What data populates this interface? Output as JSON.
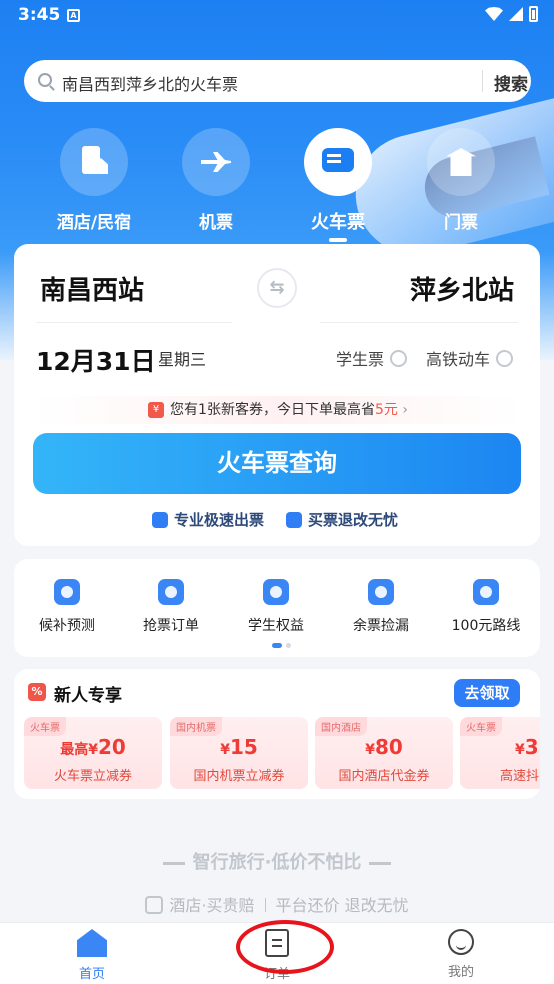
{
  "status_bar": {
    "time": "3:45",
    "notif_icon": "A"
  },
  "search": {
    "placeholder": "南昌西到萍乡北的火车票",
    "button": "搜索"
  },
  "categories": [
    {
      "label": "酒店/民宿",
      "icon": "hotel-icon"
    },
    {
      "label": "机票",
      "icon": "plane-icon"
    },
    {
      "label": "火车票",
      "icon": "train-icon",
      "active": true
    },
    {
      "label": "门票",
      "icon": "ticket-icon"
    }
  ],
  "booking": {
    "from": "南昌西站",
    "to": "萍乡北站",
    "date": "12月31日",
    "weekday": "星期三",
    "student": "学生票",
    "highspeed": "高铁动车",
    "coupon_prefix": "您有1张新客券，今日下单最高省",
    "coupon_amount": "5元",
    "query_button": "火车票查询",
    "feature1": "专业极速出票",
    "feature2": "买票退改无忧"
  },
  "tools": [
    {
      "label": "候补预测",
      "icon": "shield-chart-icon"
    },
    {
      "label": "抢票订单",
      "icon": "grab-ticket-icon"
    },
    {
      "label": "学生权益",
      "icon": "graduation-cap-icon"
    },
    {
      "label": "余票捡漏",
      "icon": "refresh-icon"
    },
    {
      "label": "100元路线",
      "icon": "location-pin-icon"
    }
  ],
  "newbie": {
    "title": "新人专享",
    "claim": "去领取",
    "vouchers": [
      {
        "tag": "火车票",
        "prefix": "最高",
        "yen": "¥",
        "amount": "20",
        "desc": "火车票立减券"
      },
      {
        "tag": "国内机票",
        "prefix": "",
        "yen": "¥",
        "amount": "15",
        "desc": "国内机票立减券"
      },
      {
        "tag": "国内酒店",
        "prefix": "",
        "yen": "¥",
        "amount": "80",
        "desc": "国内酒店代金券"
      },
      {
        "tag": "火车票",
        "prefix": "",
        "yen": "¥",
        "amount": "3",
        "desc": "高速抖"
      }
    ]
  },
  "slogan": "智行旅行·低价不怕比",
  "tagline": {
    "part1": "酒店·买贵赔",
    "part2": "平台还价 退改无忧"
  },
  "nav": [
    {
      "label": "首页",
      "icon": "home-icon",
      "active": true
    },
    {
      "label": "订单",
      "icon": "order-icon"
    },
    {
      "label": "我的",
      "icon": "profile-icon"
    }
  ],
  "colors": {
    "primary": "#2e7cf6",
    "accent_red": "#f15a4a",
    "annotation": "#e8141c"
  }
}
